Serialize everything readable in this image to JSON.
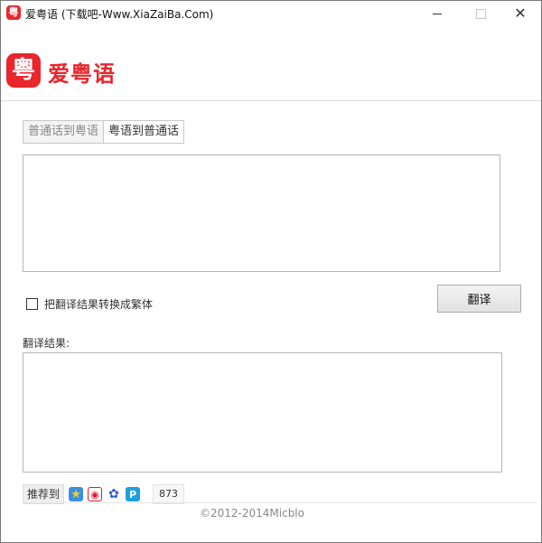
{
  "window": {
    "title": "爱粤语 (下载吧-Www.XiaZaiBa.Com)",
    "icon_glyph": "粤"
  },
  "header": {
    "logo_glyph": "粤",
    "logo_text": "爱粤语",
    "brand_color": "#e8262c"
  },
  "tabs": [
    {
      "label": "普通话到粤语",
      "active": false
    },
    {
      "label": "粤语到普通话",
      "active": true
    }
  ],
  "input": {
    "value": "",
    "placeholder": ""
  },
  "options": {
    "traditional_checkbox_label": "把翻译结果转换成繁体",
    "traditional_checked": false
  },
  "translate_button_label": "翻译",
  "result": {
    "label": "翻译结果:",
    "value": ""
  },
  "share": {
    "label": "推荐到",
    "icons": [
      "qzone-icon",
      "weibo-icon",
      "baidu-icon",
      "tencent-weibo-icon"
    ],
    "count": "873"
  },
  "footer": {
    "text": "©2012-2014Micblo"
  }
}
